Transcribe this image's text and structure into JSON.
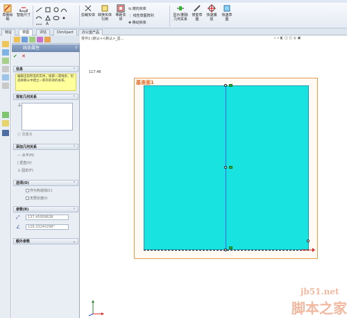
{
  "ribbon": {
    "sketch_label": "草图绘制",
    "smart_dim_label": "智能尺寸",
    "trim_label": "剪裁实体",
    "convert_label": "转换实体引用",
    "offset_label": "等距实体",
    "mirror_label": "镜向实体",
    "linear_array_label": "线性草图阵列",
    "move_label": "移动实体",
    "display_rel_label": "显示/删除几何关系",
    "repair_label": "修复草图",
    "quick_snap_label": "快速捕捉",
    "rapid_sketch_label": "快速草图"
  },
  "tabs": [
    {
      "label": "特征"
    },
    {
      "label": "草图"
    },
    {
      "label": "评估"
    },
    {
      "label": "DimXpert"
    },
    {
      "label": "办公室产品"
    }
  ],
  "panel": {
    "title": "线条属性",
    "help": "?",
    "ok_symbol": "✔",
    "cancel_symbol": "✕",
    "sections": {
      "message": "信息",
      "existing_relations": "现有几何关系",
      "add_relations": "添加几何关系",
      "options": "选项(O)",
      "parameters": "参数(R)",
      "extra_params": "额外参数"
    },
    "info_text": "编辑当前所选的实体，按第一或线条。也选择要从中建立一新的有效的关系。",
    "status": "欠定义",
    "add_relation_options": [
      "水平(H)",
      "竖直(V)",
      "固定(F)"
    ],
    "option_items": [
      "作为构造线(C)",
      "无限长度(I)"
    ],
    "param_length": "137.45958638",
    "param_angle": "129.33240298°"
  },
  "graphics": {
    "breadcrumb": "零件1 (默认<<默认>_显...",
    "dimension_text": "117.46",
    "plane_label": "基准面1"
  },
  "watermark": {
    "site": "jb51.net",
    "name": "脚本之家"
  },
  "colors": {
    "sketch_fill": "#19e3e0",
    "plane_border": "#e59a4a",
    "plane_label": "#e2661b",
    "centerline": "#2f63d8",
    "panel_title": "#6e89b1",
    "info_bg": "#ffff9c"
  }
}
